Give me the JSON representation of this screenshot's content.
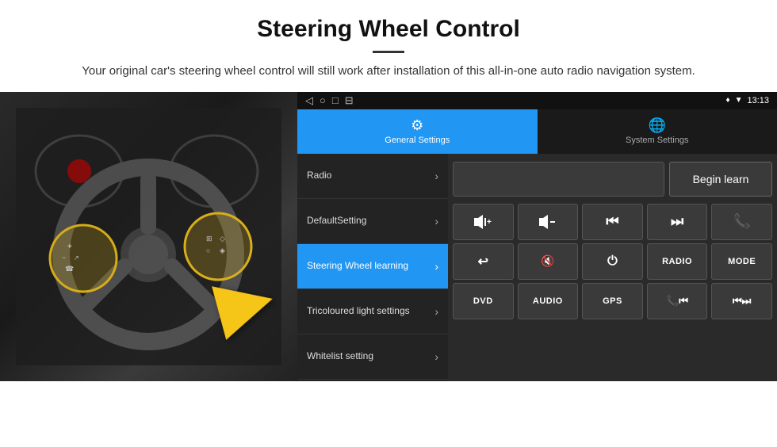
{
  "header": {
    "title": "Steering Wheel Control",
    "subtitle": "Your original car's steering wheel control will still work after installation of this all-in-one auto radio navigation system."
  },
  "status_bar": {
    "time": "13:13",
    "nav_icons": [
      "◁",
      "○",
      "□",
      "⊟"
    ]
  },
  "tabs": [
    {
      "id": "general",
      "label": "General Settings",
      "active": true
    },
    {
      "id": "system",
      "label": "System Settings",
      "active": false
    }
  ],
  "menu_items": [
    {
      "id": "radio",
      "label": "Radio",
      "active": false
    },
    {
      "id": "default",
      "label": "DefaultSetting",
      "active": false
    },
    {
      "id": "steering",
      "label": "Steering Wheel learning",
      "active": true
    },
    {
      "id": "tricolour",
      "label": "Tricoloured light settings",
      "active": false
    },
    {
      "id": "whitelist",
      "label": "Whitelist setting",
      "active": false
    }
  ],
  "controls": {
    "begin_learn_label": "Begin learn",
    "row1": [
      "🔊+",
      "🔊−",
      "⏮",
      "⏭",
      "📞"
    ],
    "row2": [
      "📞↩",
      "🔇",
      "⏻",
      "RADIO",
      "MODE"
    ],
    "row3": [
      "DVD",
      "AUDIO",
      "GPS",
      "📞⏮",
      "⏮⏭"
    ]
  }
}
